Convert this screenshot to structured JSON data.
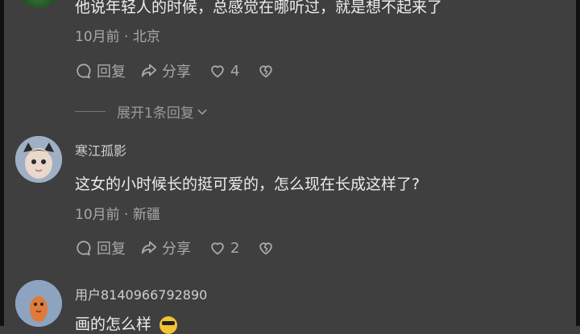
{
  "comments": [
    {
      "text": "他说年轻人的时候，总感觉在哪听过，就是想不起来了",
      "time": "10月前",
      "location": "北京",
      "reply_label": "回复",
      "share_label": "分享",
      "like_count": "4"
    },
    {
      "username": "寒江孤影",
      "text": "这女的小时候长的挺可爱的，怎么现在长成这样了?",
      "time": "10月前",
      "location": "新疆",
      "reply_label": "回复",
      "share_label": "分享",
      "like_count": "2"
    },
    {
      "username": "用户8140966792890",
      "text": "画的怎么样"
    }
  ],
  "expand_replies_label": "展开1条回复",
  "meta_separator": "·",
  "icons": [
    "reply-icon",
    "share-icon",
    "heart-icon",
    "broken-heart-icon",
    "chevron-down-icon",
    "sunglasses-emoji-icon"
  ]
}
